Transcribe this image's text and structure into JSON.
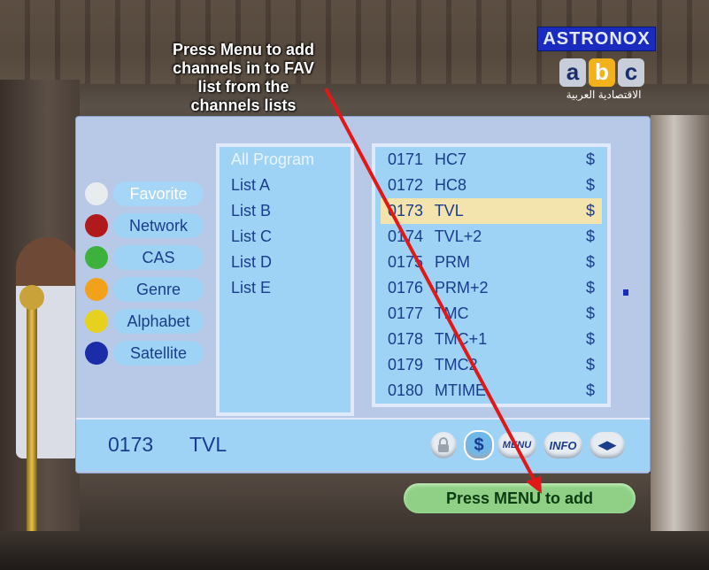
{
  "annotation": {
    "lines": [
      "Press Menu to add",
      "channels in to FAV",
      "list from the",
      "channels lists"
    ]
  },
  "overlay": {
    "brand_text": "ASTRONOX",
    "channel_logo": {
      "letters": [
        "a",
        "b",
        "c"
      ],
      "arabic_text": "الاقتصادية العربية"
    }
  },
  "categories": [
    {
      "label": "Favorite",
      "color": "#e8ecef",
      "active": true
    },
    {
      "label": "Network",
      "color": "#b01a1a",
      "active": false
    },
    {
      "label": "CAS",
      "color": "#3cb23c",
      "active": false
    },
    {
      "label": "Genre",
      "color": "#f2a21a",
      "active": false
    },
    {
      "label": "Alphabet",
      "color": "#e6d21e",
      "active": false
    },
    {
      "label": "Satellite",
      "color": "#1a2ca8",
      "active": false
    }
  ],
  "lists": [
    {
      "label": "All Program",
      "active": true
    },
    {
      "label": "List A"
    },
    {
      "label": "List B"
    },
    {
      "label": "List C"
    },
    {
      "label": "List D"
    },
    {
      "label": "List E"
    }
  ],
  "channels": [
    {
      "number": "0171",
      "name": "HC7",
      "scrambled": "$"
    },
    {
      "number": "0172",
      "name": "HC8",
      "scrambled": "$"
    },
    {
      "number": "0173",
      "name": "TVL",
      "scrambled": "$",
      "selected": true
    },
    {
      "number": "0174",
      "name": "TVL+2",
      "scrambled": "$"
    },
    {
      "number": "0175",
      "name": "PRM",
      "scrambled": "$"
    },
    {
      "number": "0176",
      "name": "PRM+2",
      "scrambled": "$"
    },
    {
      "number": "0177",
      "name": "TMC",
      "scrambled": "$"
    },
    {
      "number": "0178",
      "name": "TMC+1",
      "scrambled": "$"
    },
    {
      "number": "0179",
      "name": "TMC2",
      "scrambled": "$"
    },
    {
      "number": "0180",
      "name": "MTIME",
      "scrambled": "$"
    }
  ],
  "footer": {
    "channel_number": "0173",
    "channel_name": "TVL",
    "icons": {
      "lock": "lock-icon",
      "dollar": "$",
      "menu": "MENU",
      "info": "INFO",
      "arrows": "◀▶"
    }
  },
  "tooltip": "Press MENU to add",
  "colors": {
    "panel": "#b8c9e8",
    "list_bg": "#9fd3f5",
    "text": "#1a3c8c",
    "selection": "#f3e4ad",
    "tooltip": "#8fd086",
    "arrow": "#e01818"
  }
}
